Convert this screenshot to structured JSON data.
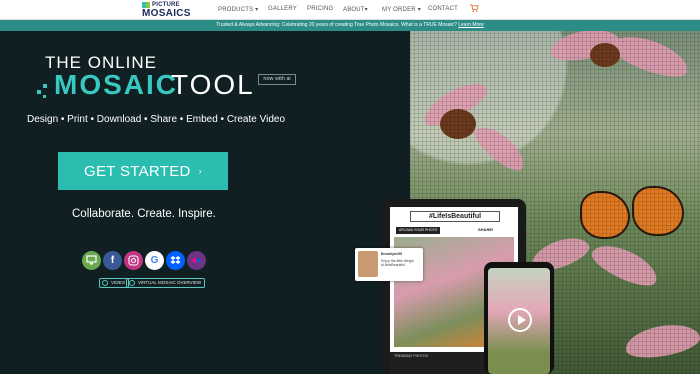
{
  "logo": {
    "line1": "PICTURE",
    "line2": "MOSAICS"
  },
  "nav": {
    "products": "PRODUCTS ▾",
    "gallery": "GALLERY",
    "pricing": "PRICING",
    "about": "ABOUT▾",
    "my_order": "MY ORDER ▾",
    "contact": "CONTACT",
    "cart_icon": "cart-icon"
  },
  "banner": {
    "text": "Trusted & Always Advancing: Celebrating 20 years of creating True Photo Mosaics. What is a TRUE Mosaic?",
    "link": "Learn More"
  },
  "hero": {
    "title_small": "THE ONLINE",
    "title_mosaic": "MOSAIC",
    "title_tool": "TOOL",
    "badge": "now with ai",
    "tagline": "Design • Print • Download • Share • Embed • Create Video",
    "cta_label": "GET STARTED",
    "cta_arrow": "›",
    "collab": "Collaborate. Create. Inspire.",
    "pills": {
      "video": "VIDEO",
      "virtual": "VIRTUAL MOSAIC OVERVIEW"
    }
  },
  "social": [
    {
      "name": "computer",
      "color": "#6aa84f"
    },
    {
      "name": "facebook",
      "color": "#3b5998",
      "glyph": "f"
    },
    {
      "name": "instagram",
      "color": "#c13584"
    },
    {
      "name": "google",
      "color": "#ffffff",
      "glyph": "G"
    },
    {
      "name": "dropbox",
      "color": "#0061ff"
    },
    {
      "name": "flickr",
      "color": "#6c3483"
    }
  ],
  "devices": {
    "hashtag": "#LifeIsBeautiful",
    "upload": "UPLOAD YOUR PHOTO",
    "share": "SHARE!",
    "trending": "TRENDING PHOTOS",
    "post_user": "Brooklyn#95",
    "post_text": "Enjoy the little things! #LifeIsBeautiful"
  },
  "colors": {
    "accent": "#2bbdaf",
    "banner": "#2c8c86",
    "hero_bg": "#0f1f22"
  }
}
